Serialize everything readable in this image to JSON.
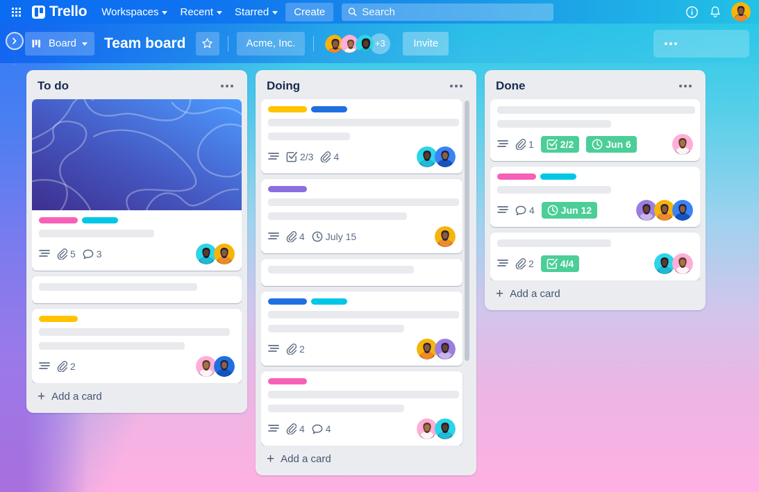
{
  "topnav": {
    "apps_icon": "grid-apps-icon",
    "brand": "Trello",
    "items": [
      {
        "label": "Workspaces",
        "has_caret": true
      },
      {
        "label": "Recent",
        "has_caret": true
      },
      {
        "label": "Starred",
        "has_caret": true
      }
    ],
    "create_label": "Create",
    "search": {
      "placeholder": "Search",
      "value": "",
      "icon": "search-icon"
    },
    "info_icon": "info-circle-icon",
    "notifications_icon": "bell-icon",
    "account_avatar": "user-avatar"
  },
  "boardbar": {
    "sidebar_toggle_icon": "chevron-right-icon",
    "view_button": {
      "label": "Board",
      "icon": "board-view-icon",
      "caret": true
    },
    "title": "Team board",
    "star_icon": "star-icon",
    "workspace": "Acme, Inc.",
    "members": [
      {
        "name": "member-1",
        "bg": "#f5b50a"
      },
      {
        "name": "member-2",
        "bg": "#ffaed7"
      },
      {
        "name": "member-3",
        "bg": "#2ed4e8"
      }
    ],
    "member_overflow": "+3",
    "invite_label": "Invite",
    "menu_icon": "more-horizontal-icon"
  },
  "lists": [
    {
      "id": "todo",
      "title": "To do",
      "menu_icon": "more-horizontal-icon",
      "add_card_label": "Add a card",
      "scrollbar": false,
      "cards": [
        {
          "cover": {
            "type": "abstract-gradient",
            "from": "#3d2f8f",
            "to": "#4c9bff"
          },
          "labels": [
            {
              "color": "#f760b8"
            },
            {
              "color": "#00c7e5"
            }
          ],
          "title_lines": [
            166
          ],
          "badges": [
            {
              "type": "description",
              "icon": "description-icon"
            },
            {
              "type": "attachment",
              "icon": "attachment-icon",
              "text": "5"
            },
            {
              "type": "comment",
              "icon": "comment-icon",
              "text": "3"
            }
          ],
          "avatars": [
            {
              "bg": "#2ed4e8"
            },
            {
              "bg": "#f5b50a"
            }
          ]
        },
        {
          "labels": [],
          "title_lines": [
            228
          ],
          "badges": [],
          "avatars": []
        },
        {
          "labels": [
            {
              "color": "#ffc300"
            }
          ],
          "title_lines": [
            275,
            210
          ],
          "badges": [
            {
              "type": "description",
              "icon": "description-icon"
            },
            {
              "type": "attachment",
              "icon": "attachment-icon",
              "text": "2"
            }
          ],
          "avatars": [
            {
              "bg": "#ffaed7"
            },
            {
              "bg": "#1f6fe0"
            }
          ]
        }
      ]
    },
    {
      "id": "doing",
      "title": "Doing",
      "menu_icon": "more-horizontal-icon",
      "add_card_label": "Add a card",
      "scrollbar": true,
      "cards": [
        {
          "labels": [
            {
              "color": "#ffc300"
            },
            {
              "color": "#1f6fe0"
            }
          ],
          "title_lines": [
            275,
            118
          ],
          "badges": [
            {
              "type": "description",
              "icon": "description-icon"
            },
            {
              "type": "checklist",
              "icon": "checklist-icon",
              "text": "2/3"
            },
            {
              "type": "attachment",
              "icon": "attachment-icon",
              "text": "4"
            }
          ],
          "avatars": [
            {
              "bg": "#2ed4e8"
            },
            {
              "bg": "#3b82f4"
            }
          ]
        },
        {
          "labels": [
            {
              "color": "#8b6ee0"
            }
          ],
          "title_lines": [
            275,
            200
          ],
          "badges": [
            {
              "type": "description",
              "icon": "description-icon"
            },
            {
              "type": "attachment",
              "icon": "attachment-icon",
              "text": "4"
            },
            {
              "type": "due-date",
              "icon": "clock-icon",
              "text": "July 15"
            }
          ],
          "avatars": [
            {
              "bg": "#f5b50a"
            }
          ]
        },
        {
          "labels": [],
          "title_lines": [
            210
          ],
          "badges": [],
          "avatars": []
        },
        {
          "labels": [
            {
              "color": "#1f6fe0"
            },
            {
              "color": "#00c7e5"
            }
          ],
          "title_lines": [
            275,
            196
          ],
          "badges": [
            {
              "type": "description",
              "icon": "description-icon"
            },
            {
              "type": "attachment",
              "icon": "attachment-icon",
              "text": "2"
            }
          ],
          "avatars": [
            {
              "bg": "#f5b50a"
            },
            {
              "bg": "#9a7ee0"
            }
          ]
        },
        {
          "labels": [
            {
              "color": "#f760b8"
            }
          ],
          "title_lines": [
            275,
            196
          ],
          "badges": [
            {
              "type": "description",
              "icon": "description-icon"
            },
            {
              "type": "attachment",
              "icon": "attachment-icon",
              "text": "4"
            },
            {
              "type": "comment",
              "icon": "comment-icon",
              "text": "4"
            }
          ],
          "avatars": [
            {
              "bg": "#ffaed7"
            },
            {
              "bg": "#2ed4e8"
            }
          ]
        }
      ]
    },
    {
      "id": "done",
      "title": "Done",
      "menu_icon": "more-horizontal-icon",
      "add_card_label": "Add a card",
      "scrollbar": false,
      "cards": [
        {
          "labels": [],
          "title_lines": [
            285,
            164
          ],
          "badges": [
            {
              "type": "description",
              "icon": "description-icon"
            },
            {
              "type": "attachment",
              "icon": "attachment-icon",
              "text": "1"
            },
            {
              "type": "checklist",
              "icon": "checklist-icon",
              "text": "2/2",
              "style": "green"
            },
            {
              "type": "due-date",
              "icon": "clock-icon",
              "text": "Jun 6",
              "style": "green"
            }
          ],
          "avatars": [
            {
              "bg": "#ffaed7"
            }
          ]
        },
        {
          "labels": [
            {
              "color": "#f760b8"
            },
            {
              "color": "#00c7e5"
            }
          ],
          "title_lines": [
            164
          ],
          "badges": [
            {
              "type": "description",
              "icon": "description-icon"
            },
            {
              "type": "comment",
              "icon": "comment-icon",
              "text": "4"
            },
            {
              "type": "due-date",
              "icon": "clock-icon",
              "text": "Jun 12",
              "style": "green"
            }
          ],
          "avatars": [
            {
              "bg": "#9a7ee0"
            },
            {
              "bg": "#f5b50a"
            },
            {
              "bg": "#3b82f4"
            }
          ]
        },
        {
          "labels": [],
          "title_lines": [
            164
          ],
          "badges": [
            {
              "type": "description",
              "icon": "description-icon"
            },
            {
              "type": "attachment",
              "icon": "attachment-icon",
              "text": "2"
            },
            {
              "type": "checklist",
              "icon": "checklist-icon",
              "text": "4/4",
              "style": "green"
            }
          ],
          "avatars": [
            {
              "bg": "#2ed4e8"
            },
            {
              "bg": "#ffaed7"
            }
          ]
        }
      ]
    }
  ],
  "colors": {
    "nav_blue": "#0b6bf2",
    "nav_cyan": "#22c2e6",
    "list_bg": "#ebecf0",
    "green_badge": "#4bce97",
    "text_dark": "#172b4d",
    "text_muted": "#5e6c84"
  }
}
